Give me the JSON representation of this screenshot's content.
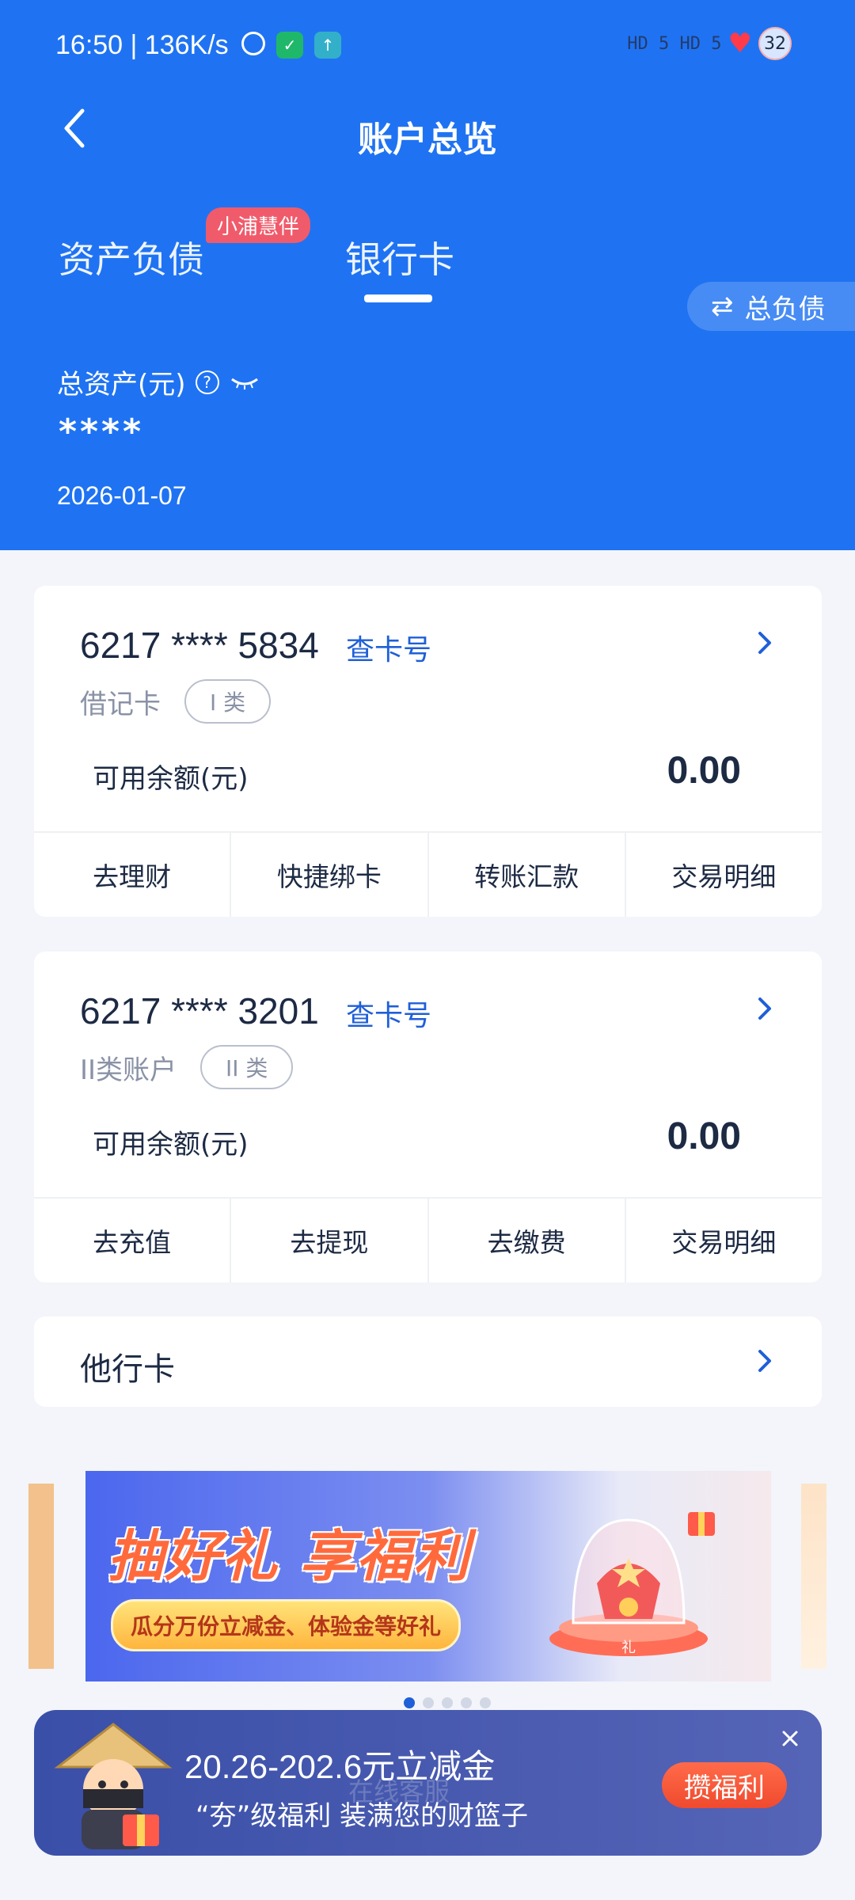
{
  "status_bar": {
    "time": "16:50 | 136K/s",
    "signal": "HD 5 HD 5",
    "battery": "32"
  },
  "header": {
    "title": "账户总览",
    "tabs": [
      {
        "label": "资产负债",
        "active": false
      },
      {
        "label": "银行卡",
        "active": true
      }
    ],
    "badge": "小浦慧伴",
    "debt_toggle_label": "总负债",
    "total_assets_label": "总资产(元)",
    "total_assets_value": "****",
    "date": "2026-01-07"
  },
  "cards": [
    {
      "number": "6217 **** 5834",
      "lookup_label": "查卡号",
      "type": "借记卡",
      "level": "I 类",
      "balance_label": "可用余额(元)",
      "balance": "0.00",
      "actions": [
        "去理财",
        "快捷绑卡",
        "转账汇款",
        "交易明细"
      ]
    },
    {
      "number": "6217 **** 3201",
      "lookup_label": "查卡号",
      "type": "II类账户",
      "level": "II 类",
      "balance_label": "可用余额(元)",
      "balance": "0.00",
      "actions": [
        "去充值",
        "去提现",
        "去缴费",
        "交易明细"
      ]
    }
  ],
  "other_cards": {
    "label": "他行卡"
  },
  "banner": {
    "title": "抽好礼 享福利",
    "subtitle": "瓜分万份立减金、体验金等好礼",
    "gift_label": "礼",
    "dots": 5,
    "active_dot": 0
  },
  "promo": {
    "main": "20.26-202.6元立减金",
    "sub": "“夯”级福利 装满您的财篮子",
    "button": "攒福利"
  },
  "service": {
    "label": "在线客服"
  },
  "colors": {
    "primary": "#1f73f2",
    "link": "#1f5fd8",
    "promo_bg": "#3a4fa8",
    "promo_btn": "#f04a2e"
  }
}
